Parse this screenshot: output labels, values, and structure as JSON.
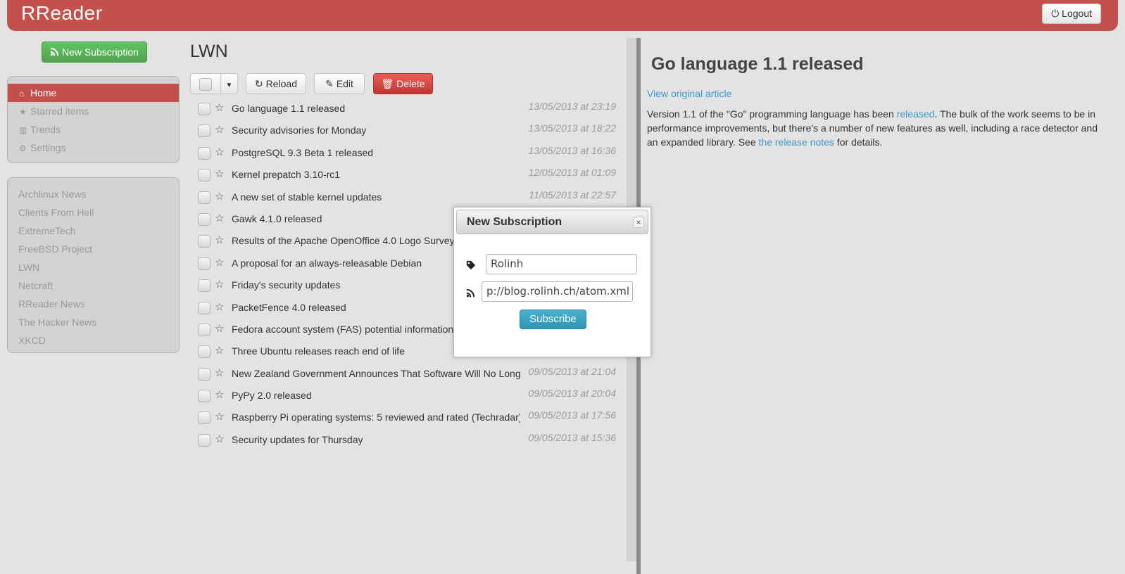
{
  "app": {
    "brand": "RReader",
    "logout_label": "Logout"
  },
  "sidebar": {
    "new_subscription_label": "New Subscription",
    "nav": [
      {
        "label": "Home",
        "icon": "home-icon",
        "active": true
      },
      {
        "label": "Starred items",
        "icon": "star-icon"
      },
      {
        "label": "Trends",
        "icon": "chart-icon"
      },
      {
        "label": "Settings",
        "icon": "gear-icon"
      }
    ],
    "feeds": [
      "Archlinux News",
      "Clients From Hell",
      "ExtremeTech",
      "FreeBSD Project",
      "LWN",
      "Netcraft",
      "RReader News",
      "The Hacker News",
      "XKCD"
    ]
  },
  "feed": {
    "title": "LWN",
    "toolbar": {
      "reload": "Reload",
      "edit": "Edit",
      "delete": "Delete"
    },
    "articles": [
      {
        "title": "Go language 1.1 released",
        "date": "13/05/2013 at 23:19"
      },
      {
        "title": "Security advisories for Monday",
        "date": "13/05/2013 at 18:22"
      },
      {
        "title": "PostgreSQL 9.3 Beta 1 released",
        "date": "13/05/2013 at 16:36"
      },
      {
        "title": "Kernel prepatch 3.10-rc1",
        "date": "12/05/2013 at 01:09"
      },
      {
        "title": "A new set of stable kernel updates",
        "date": "11/05/2013 at 22:57"
      },
      {
        "title": "Gawk 4.1.0 released",
        "date": ""
      },
      {
        "title": "Results of the Apache OpenOffice 4.0 Logo Survey",
        "date": ""
      },
      {
        "title": "A proposal for an always-releasable Debian",
        "date": ""
      },
      {
        "title": "Friday's security updates",
        "date": ""
      },
      {
        "title": "PacketFence 4.0 released",
        "date": ""
      },
      {
        "title": "Fedora account system (FAS) potential information",
        "date": ""
      },
      {
        "title": "Three Ubuntu releases reach end of life",
        "date": ""
      },
      {
        "title": "New Zealand Government Announces That Software Will No Longer",
        "date": "09/05/2013 at 21:04"
      },
      {
        "title": "PyPy 2.0 released",
        "date": "09/05/2013 at 20:04"
      },
      {
        "title": "Raspberry Pi operating systems: 5 reviewed and rated (Techradar)",
        "date": "09/05/2013 at 17:56"
      },
      {
        "title": "Security updates for Thursday",
        "date": "09/05/2013 at 15:36"
      }
    ]
  },
  "article": {
    "heading": "Go language 1.1 released",
    "original_link": "View original article",
    "body": {
      "part1": "Version 1.1 of the \"Go\" programming language has been ",
      "link1": "released",
      "part2": ". The bulk of the work seems to be in performance improvements, but there's a number of new features as well, including a race detector and an expanded library. See ",
      "link2": "the release notes",
      "part3": " for details."
    }
  },
  "modal": {
    "title": "New Subscription",
    "close_label": "×",
    "name_value": "Rolinh",
    "url_value": "p://blog.rolinh.ch/atom.xml",
    "subscribe_label": "Subscribe"
  },
  "colors": {
    "brand": "#c4504b",
    "success": "#51a351",
    "info": "#2f96b4",
    "danger": "#bd362f",
    "link": "#3a9bcd"
  }
}
